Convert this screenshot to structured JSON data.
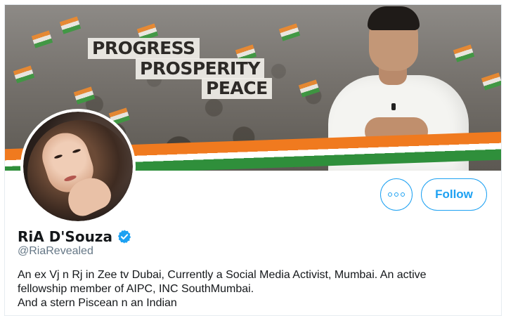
{
  "banner": {
    "slogan_lines": [
      "PROGRESS",
      "PROSPERITY",
      "PEACE"
    ],
    "flag_colors": {
      "saffron": "#f08a2c",
      "white": "#f4f1ea",
      "green": "#3b9a3f"
    }
  },
  "profile": {
    "name": "RiA D'Souza",
    "handle": "@RiaRevealed",
    "verified": true,
    "bio_lines": [
      "An ex Vj n Rj in Zee tv Dubai, Currently a Social Media Activist, Mumbai. An active",
      "fellowship member of AIPC, INC SouthMumbai.",
      "And a stern Piscean n an Indian"
    ]
  },
  "actions": {
    "more_icon": "more-dots-icon",
    "follow_label": "Follow"
  },
  "colors": {
    "accent": "#1da1f2",
    "text": "#14171a",
    "secondary_text": "#657786"
  }
}
